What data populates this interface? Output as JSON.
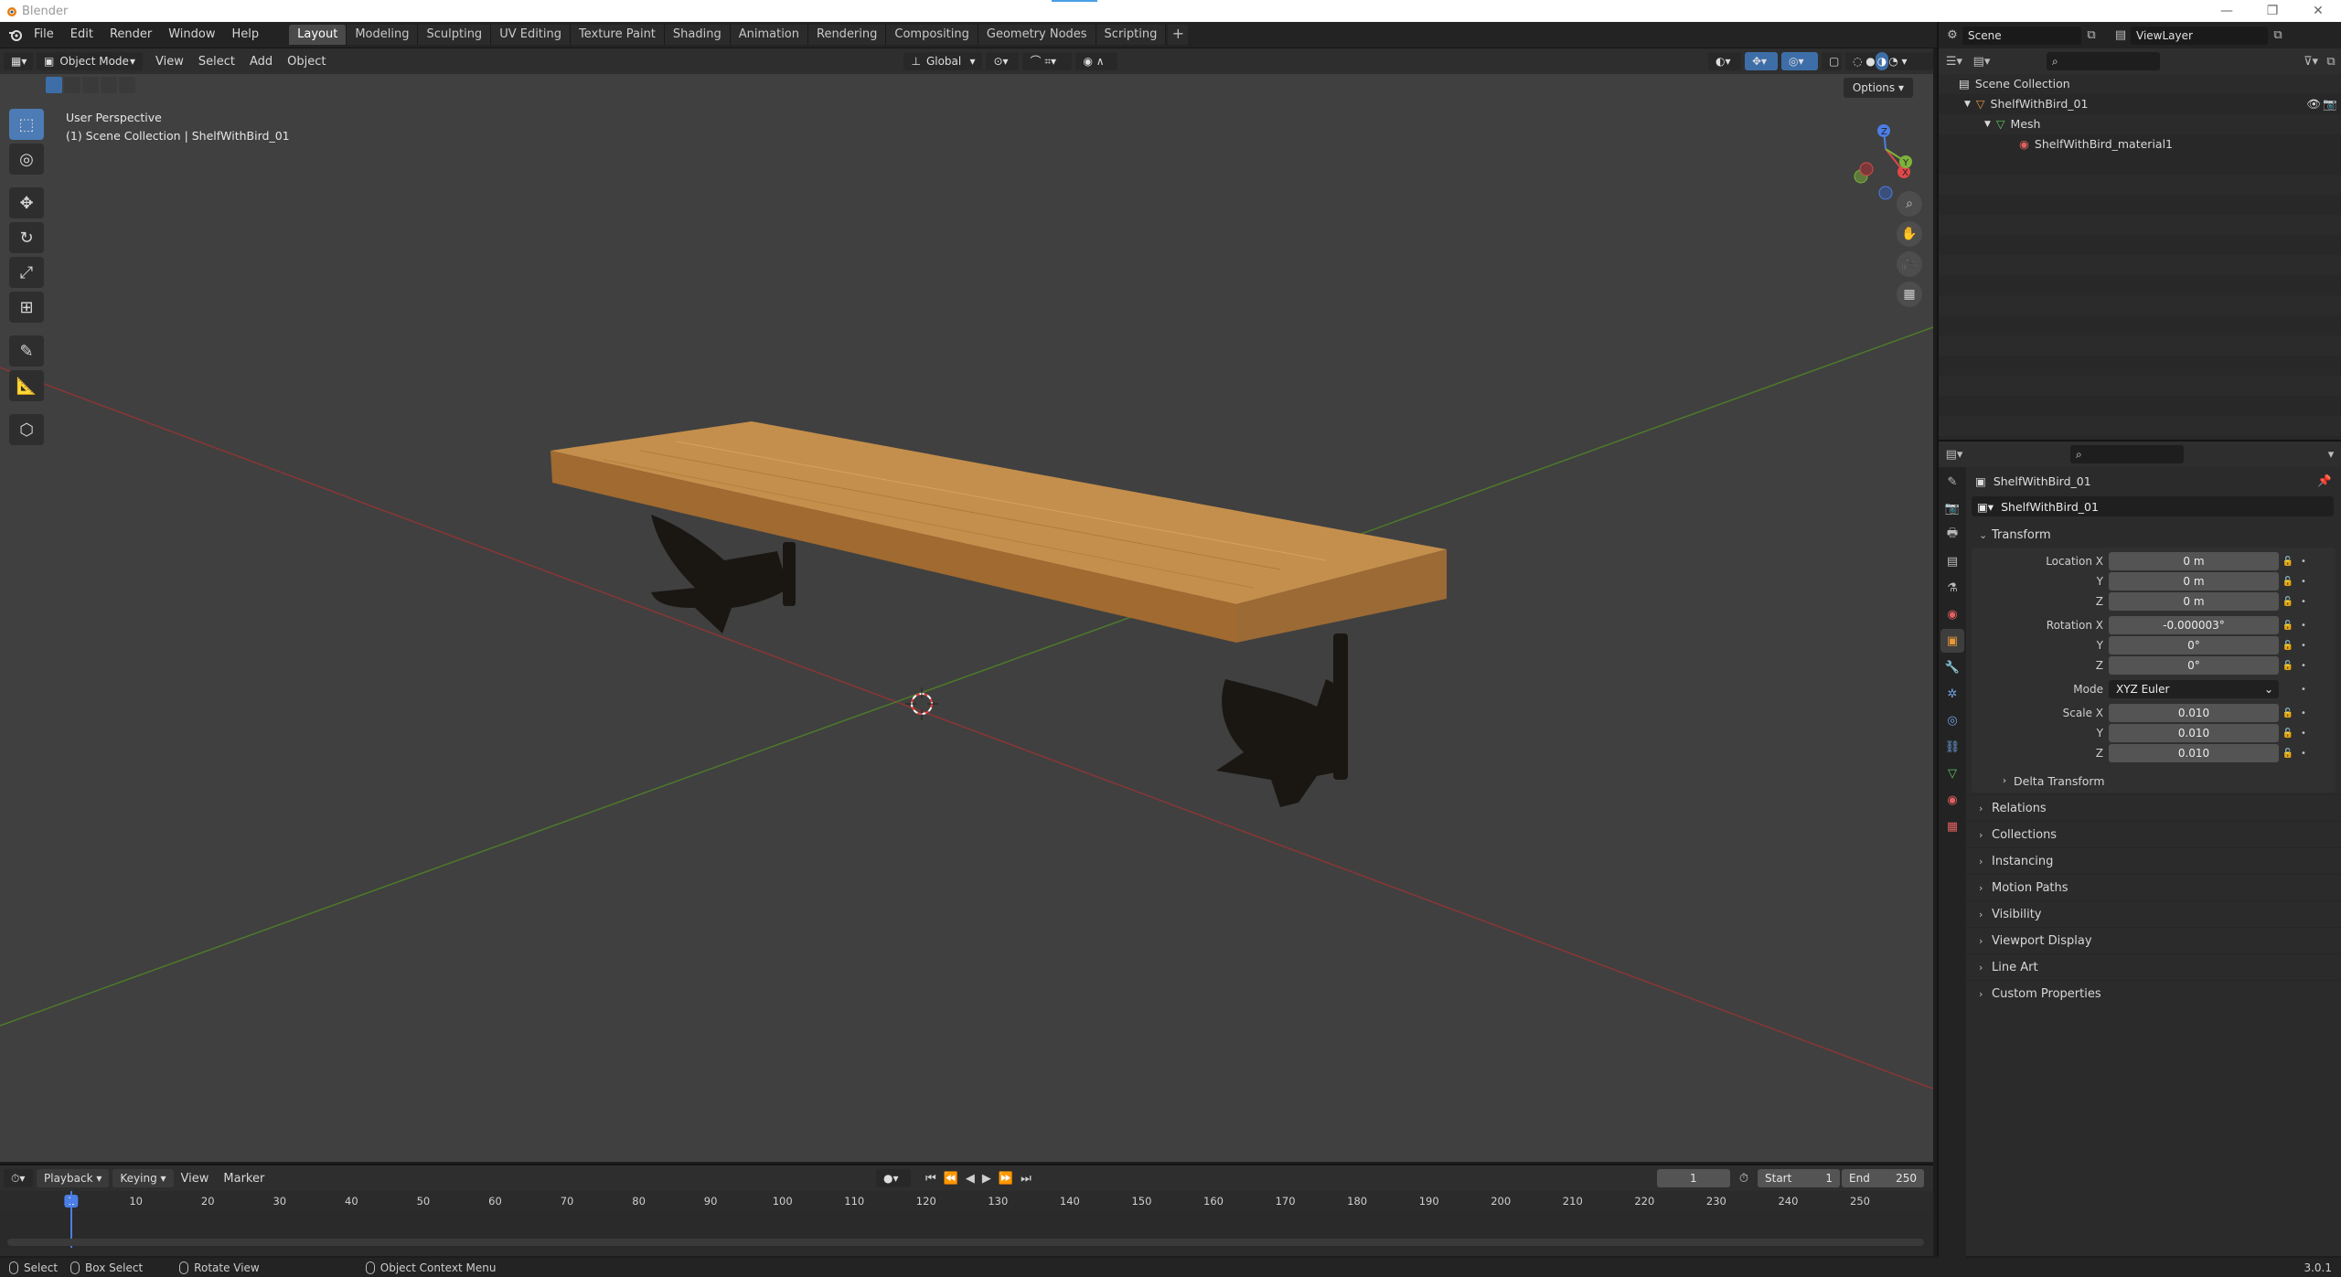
{
  "window": {
    "title": "Blender",
    "min": "—",
    "max": "❐",
    "close": "✕"
  },
  "menus": [
    "File",
    "Edit",
    "Render",
    "Window",
    "Help"
  ],
  "workspaces": [
    "Layout",
    "Modeling",
    "Sculpting",
    "UV Editing",
    "Texture Paint",
    "Shading",
    "Animation",
    "Rendering",
    "Compositing",
    "Geometry Nodes",
    "Scripting"
  ],
  "active_workspace": "Layout",
  "scene": {
    "scene_name": "Scene",
    "view_layer": "ViewLayer"
  },
  "viewport": {
    "mode": "Object Mode",
    "menus": [
      "View",
      "Select",
      "Add",
      "Object"
    ],
    "orientation": "Global",
    "perspective": "User Perspective",
    "collection_info": "(1) Scene Collection | ShelfWithBird_01",
    "options_label": "Options",
    "gizmo_axes": {
      "x": "X",
      "y": "Y",
      "z": "Z"
    }
  },
  "outliner": {
    "rows": [
      {
        "label": "Scene Collection"
      },
      {
        "label": "ShelfWithBird_01"
      },
      {
        "label": "Mesh"
      },
      {
        "label": "ShelfWithBird_material1"
      }
    ]
  },
  "properties": {
    "object_name": "ShelfWithBird_01",
    "object_field": "ShelfWithBird_01",
    "transform": {
      "title": "Transform",
      "location": {
        "label": "Location X",
        "x": "0 m",
        "y": "0 m",
        "z": "0 m"
      },
      "rotation": {
        "label": "Rotation X",
        "x": "-0.000003°",
        "y": "0°",
        "z": "0°"
      },
      "mode": {
        "label": "Mode",
        "value": "XYZ Euler"
      },
      "scale": {
        "label": "Scale X",
        "x": "0.010",
        "y": "0.010",
        "z": "0.010"
      },
      "y_label": "Y",
      "z_label": "Z",
      "delta": "Delta Transform"
    },
    "panels": [
      "Relations",
      "Collections",
      "Instancing",
      "Motion Paths",
      "Visibility",
      "Viewport Display",
      "Line Art",
      "Custom Properties"
    ]
  },
  "timeline": {
    "menus": {
      "playback": "Playback",
      "keying": "Keying",
      "view": "View",
      "marker": "Marker"
    },
    "current_frame": "1",
    "start_label": "Start",
    "start": "1",
    "end_label": "End",
    "end": "250",
    "ticks": [
      "1",
      "10",
      "20",
      "30",
      "40",
      "50",
      "60",
      "70",
      "80",
      "90",
      "100",
      "110",
      "120",
      "130",
      "140",
      "150",
      "160",
      "170",
      "180",
      "190",
      "200",
      "210",
      "220",
      "230",
      "240",
      "250"
    ]
  },
  "status": {
    "select": "Select",
    "box_select": "Box Select",
    "rotate_view": "Rotate View",
    "context_menu": "Object Context Menu",
    "version": "3.0.1"
  }
}
